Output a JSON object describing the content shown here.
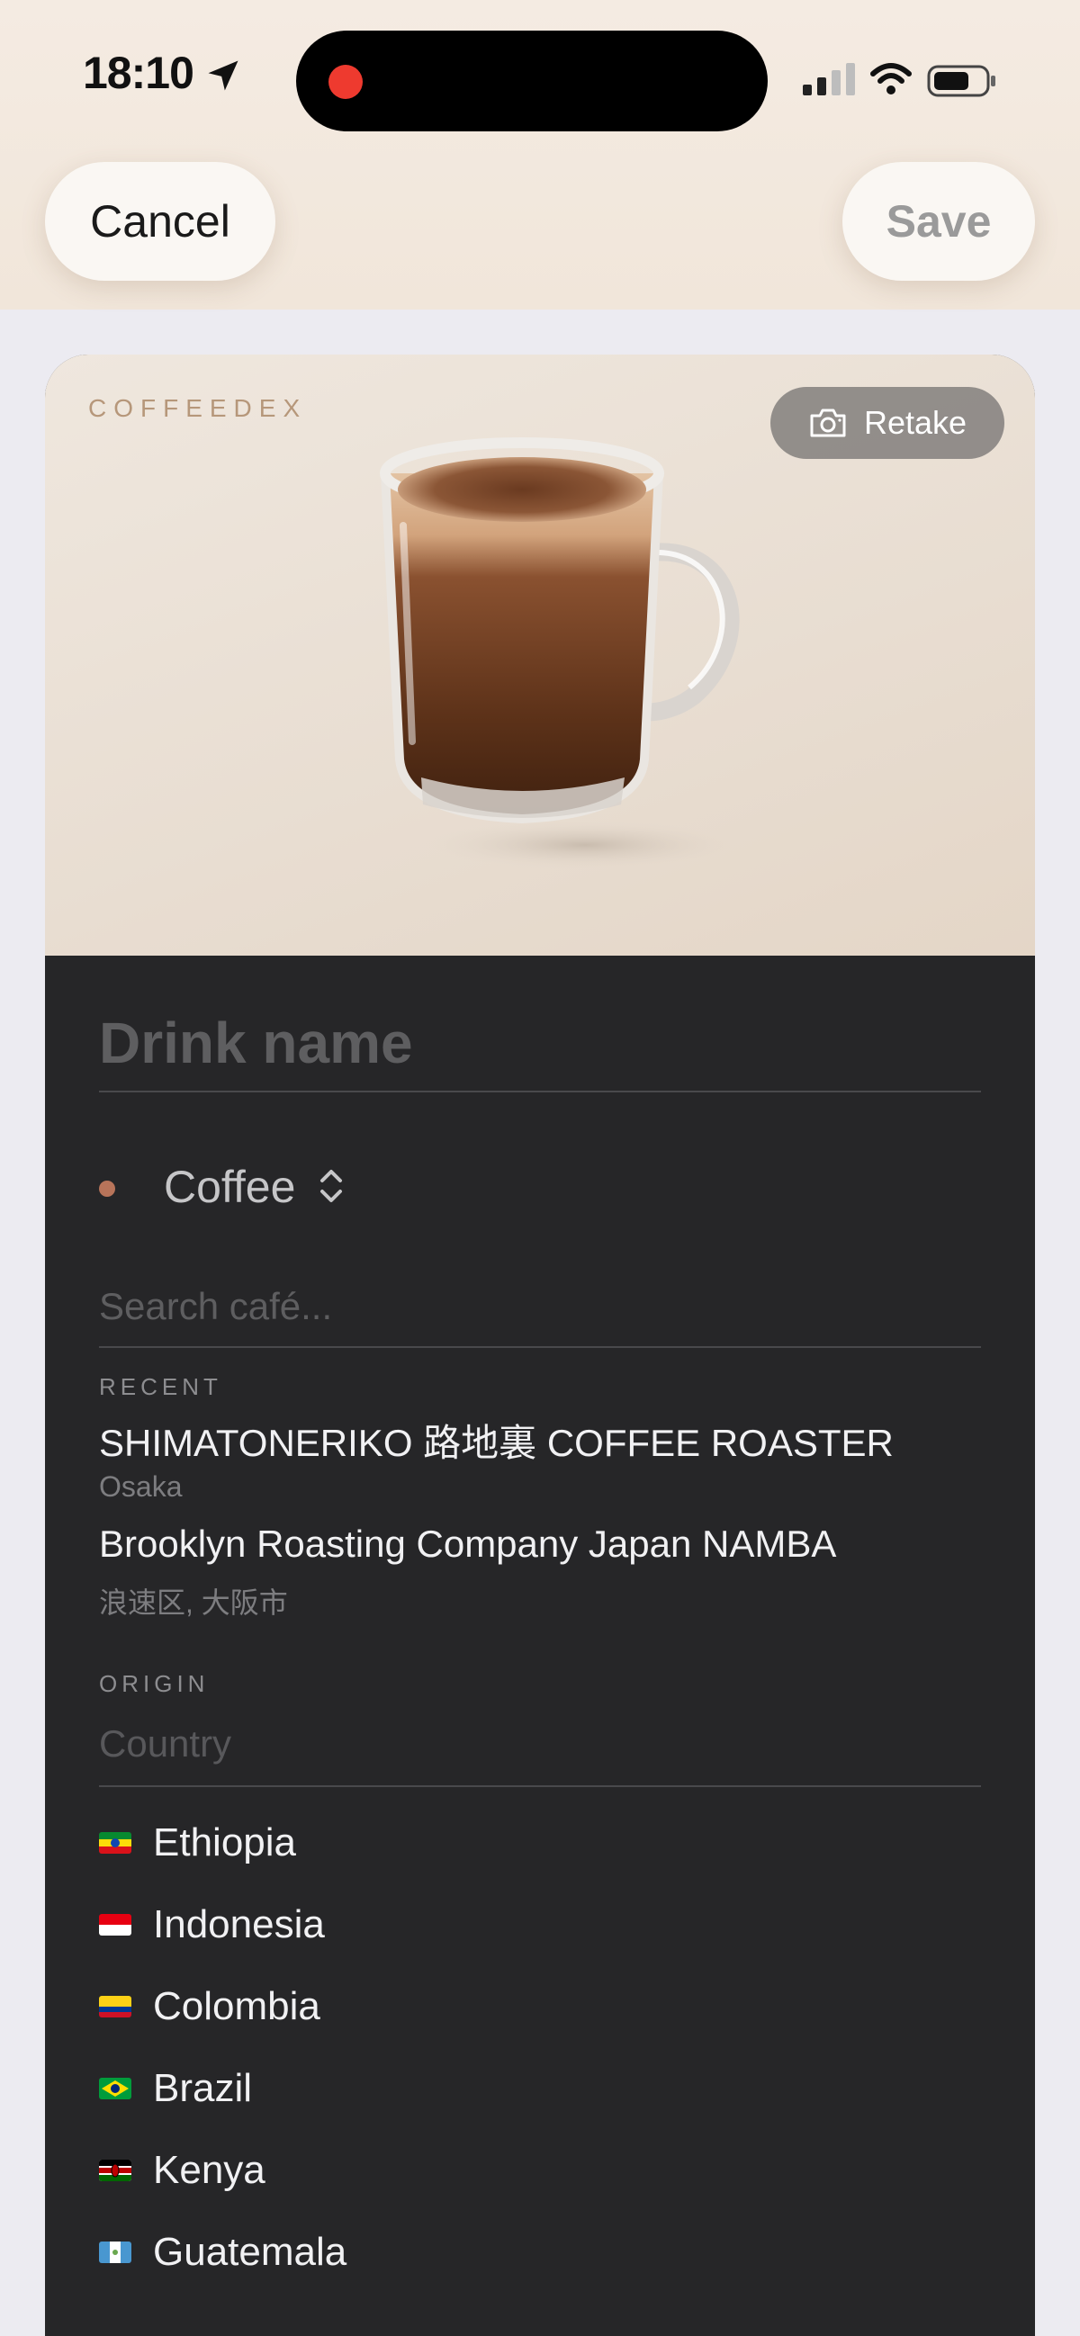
{
  "status_bar": {
    "time": "18:10"
  },
  "nav": {
    "cancel_label": "Cancel",
    "save_label": "Save"
  },
  "hero": {
    "brand": "COFFEEDEX",
    "retake_label": "Retake"
  },
  "form": {
    "drink_name_placeholder": "Drink name",
    "type_value": "Coffee",
    "search_placeholder": "Search café...",
    "recent_label": "RECENT",
    "recent_cafes": [
      {
        "name": "SHIMATONERIKO 路地裏 COFFEE ROASTER",
        "location": "Osaka"
      },
      {
        "name": "Brooklyn Roasting Company Japan NAMBA",
        "location": "浪速区, 大阪市"
      }
    ],
    "origin_label": "ORIGIN",
    "country_placeholder": "Country",
    "countries": [
      {
        "name": "Ethiopia",
        "flag": "ethiopia-flag-icon"
      },
      {
        "name": "Indonesia",
        "flag": "indonesia-flag-icon"
      },
      {
        "name": "Colombia",
        "flag": "colombia-flag-icon"
      },
      {
        "name": "Brazil",
        "flag": "brazil-flag-icon"
      },
      {
        "name": "Kenya",
        "flag": "kenya-flag-icon"
      },
      {
        "name": "Guatemala",
        "flag": "guatemala-flag-icon"
      }
    ]
  },
  "colors": {
    "accent_dot": "#b8745a",
    "card_dark": "#262628",
    "recording_dot": "#ee3a2f",
    "brand_text": "#b6977a"
  }
}
